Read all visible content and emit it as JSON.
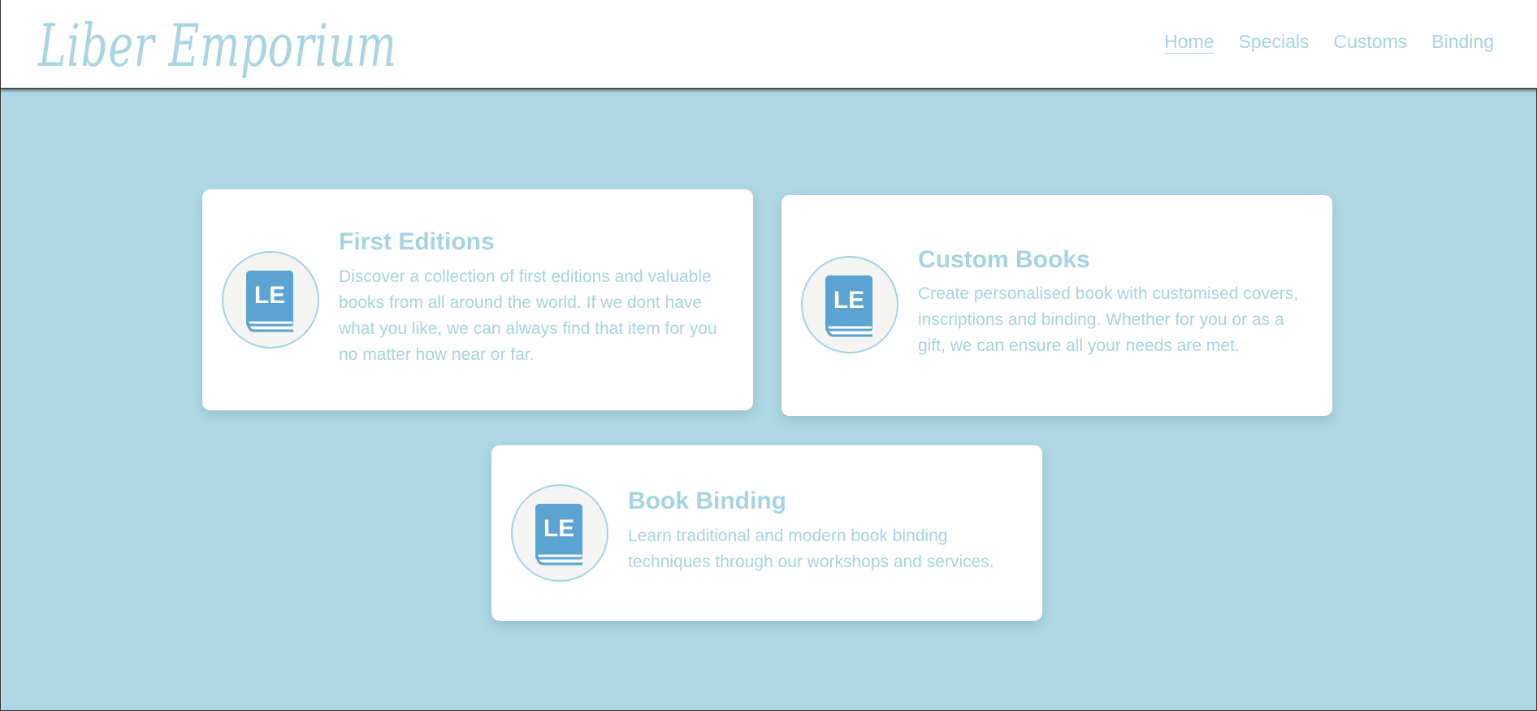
{
  "header": {
    "logo": "Liber Emporium",
    "nav": [
      {
        "label": "Home",
        "active": true
      },
      {
        "label": "Specials",
        "active": false
      },
      {
        "label": "Customs",
        "active": false
      },
      {
        "label": "Binding",
        "active": false
      }
    ]
  },
  "cards": [
    {
      "icon": "book-logo-icon",
      "icon_text": "LE",
      "title": "First Editions",
      "description": "Discover a collection of first editions and valuable books from all around the world. If we dont have what you like, we can always find that item for you no matter how near or far."
    },
    {
      "icon": "book-logo-icon",
      "icon_text": "LE",
      "title": "Custom Books",
      "description": "Create personalised book with customised covers, inscriptions and binding. Whether for you or as a gift, we can ensure all your needs are met."
    },
    {
      "icon": "book-logo-icon",
      "icon_text": "LE",
      "title": "Book Binding",
      "description": "Learn traditional and modern book binding techniques through our workshops and services."
    }
  ],
  "colors": {
    "background": "#afd7e4",
    "accent": "#a6d3e2",
    "book_cover": "#5ba3d0",
    "card": "#ffffff"
  }
}
